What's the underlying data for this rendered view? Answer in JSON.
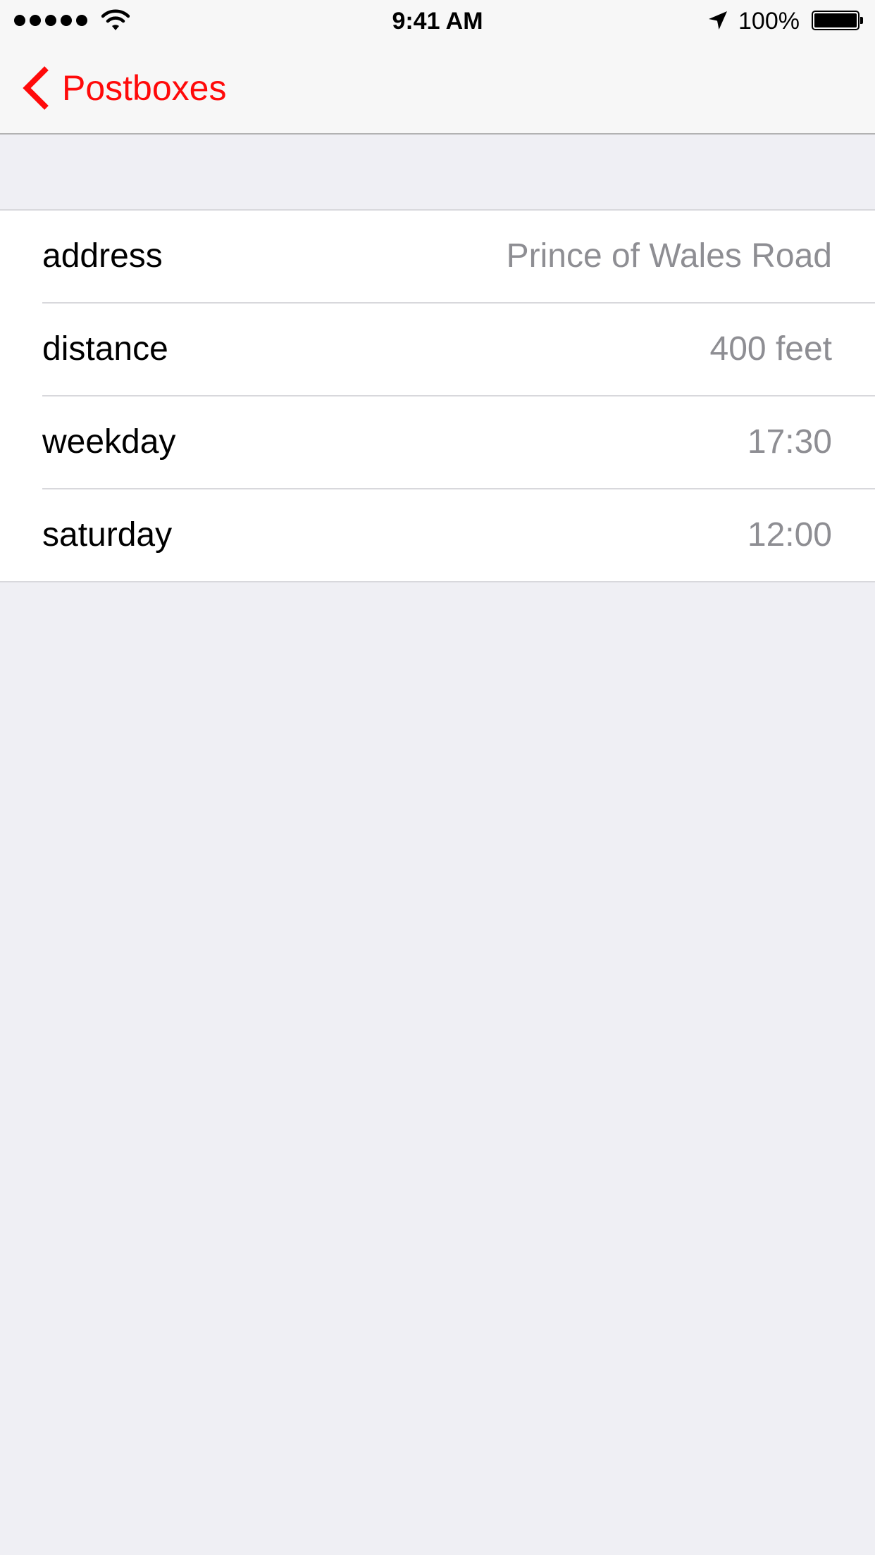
{
  "status_bar": {
    "time": "9:41 AM",
    "battery_percent": "100%",
    "signal_bars": 5,
    "icons": [
      "signal-dots-icon",
      "wifi-icon",
      "location-arrow-icon",
      "battery-icon"
    ]
  },
  "nav": {
    "back_label": "Postboxes",
    "accent_color": "#ff0a0a"
  },
  "details": [
    {
      "label": "address",
      "value": "Prince of Wales Road"
    },
    {
      "label": "distance",
      "value": "400 feet"
    },
    {
      "label": "weekday",
      "value": "17:30"
    },
    {
      "label": "saturday",
      "value": "12:00"
    }
  ],
  "colors": {
    "background": "#efeff4",
    "value_text": "#8e8e93",
    "label_text": "#000000"
  }
}
